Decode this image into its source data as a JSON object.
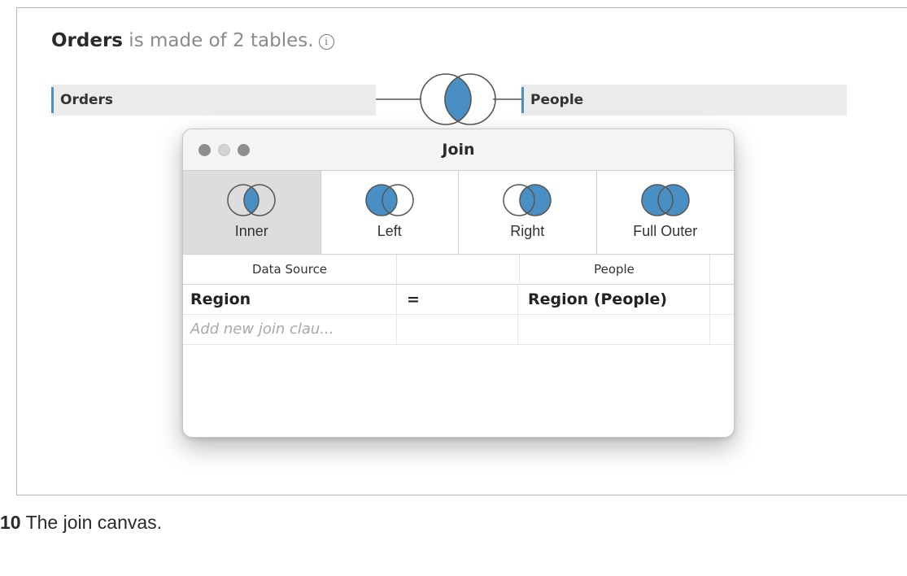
{
  "headline": {
    "table_name": "Orders",
    "rest": " is made of 2 tables.",
    "info_glyph": "i"
  },
  "canvas": {
    "left_table": "Orders",
    "right_table": "People"
  },
  "dialog": {
    "title": "Join",
    "join_types": [
      {
        "label": "Inner",
        "icon": "venn-inner-icon",
        "selected": true
      },
      {
        "label": "Left",
        "icon": "venn-left-icon",
        "selected": false
      },
      {
        "label": "Right",
        "icon": "venn-right-icon",
        "selected": false
      },
      {
        "label": "Full Outer",
        "icon": "venn-full-outer-icon",
        "selected": false
      }
    ],
    "columns": {
      "left": "Data Source",
      "middle": "",
      "right": "People"
    },
    "clauses": [
      {
        "left": "Region",
        "operator": "=",
        "right": "Region (People)"
      }
    ],
    "add_clause_placeholder": "Add new join clau..."
  },
  "caption": {
    "number": "10",
    "text": " The join canvas."
  },
  "colors": {
    "venn_fill": "#4a8fc4",
    "accent_bar": "#4a8fc4",
    "selected_type_bg": "#dddddd"
  }
}
